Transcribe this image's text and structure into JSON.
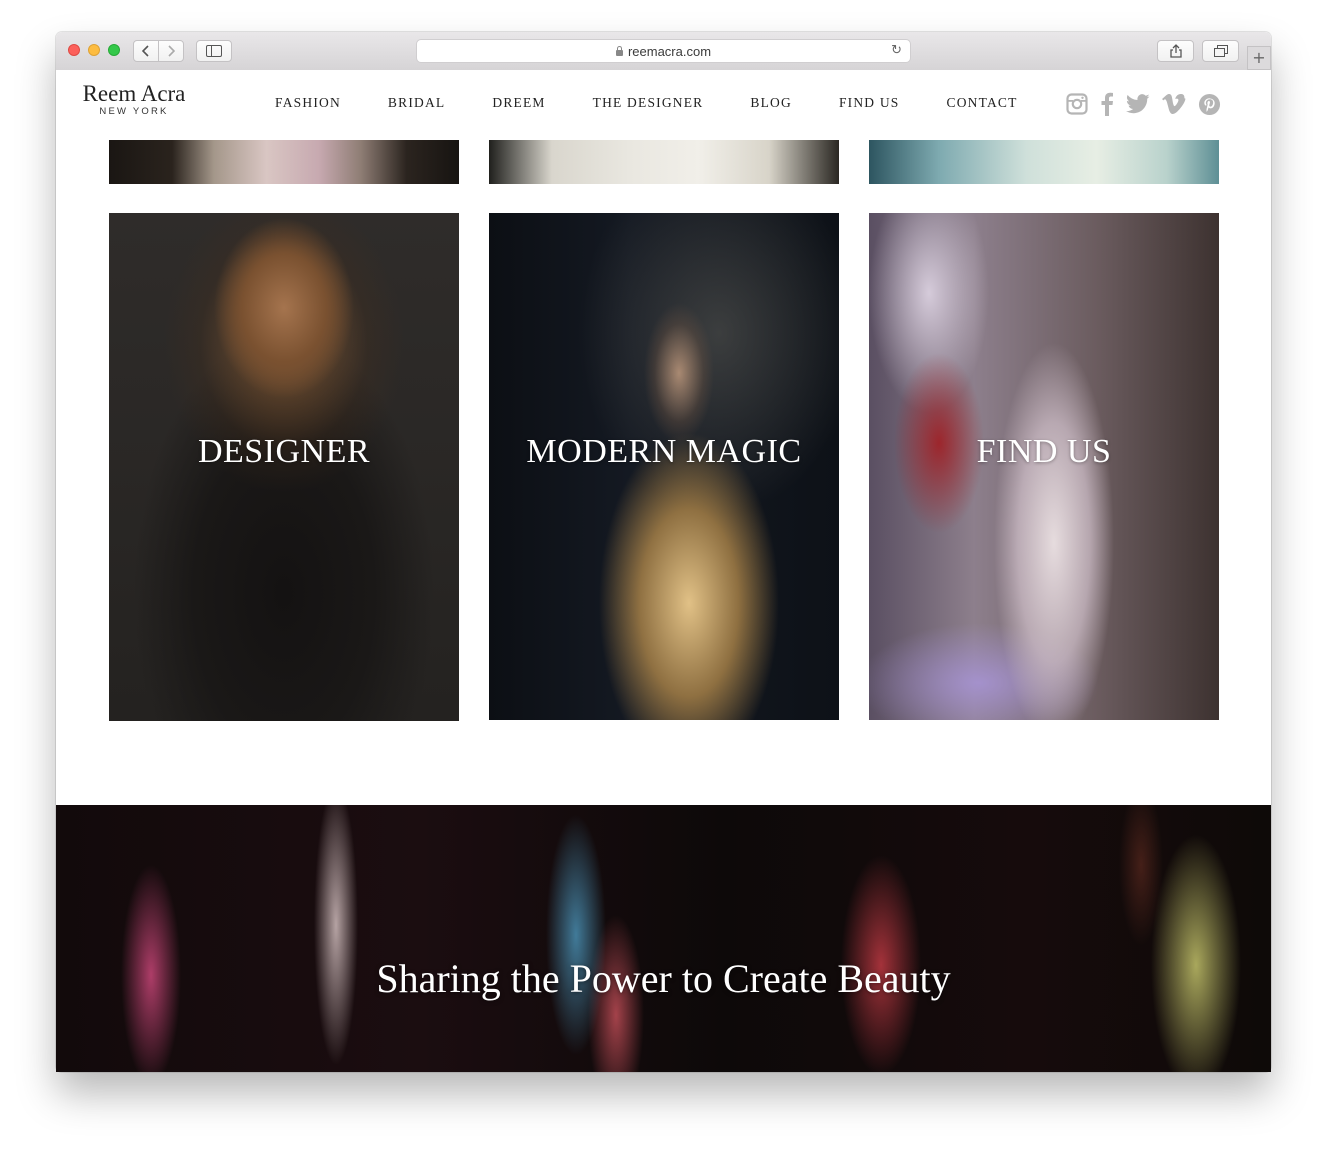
{
  "browser": {
    "url": "reemacra.com"
  },
  "site": {
    "logo": {
      "name": "Reem Acra",
      "tagline": "NEW YORK"
    },
    "nav": [
      "FASHION",
      "BRIDAL",
      "DREEM",
      "THE DESIGNER",
      "BLOG",
      "FIND US",
      "CONTACT"
    ],
    "social": [
      "instagram-icon",
      "facebook-icon",
      "twitter-icon",
      "vimeo-icon",
      "pinterest-icon"
    ],
    "social_color": "#b5b5b5"
  },
  "tiles": {
    "designer": "DESIGNER",
    "magic": "MODERN MAGIC",
    "findus": "FIND US"
  },
  "banner": {
    "title": "Sharing the Power to Create Beauty"
  }
}
